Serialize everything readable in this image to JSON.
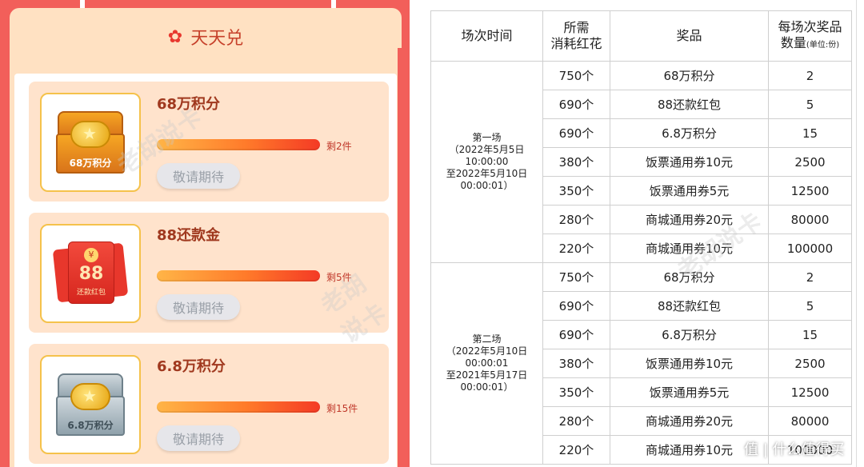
{
  "left": {
    "header_title": "天天兑",
    "items": [
      {
        "name": "68万积分",
        "thumb_label": "68万积分",
        "remain": "剩2件",
        "button": "敬请期待",
        "thumb_icon": "gold-chest-icon",
        "stock_level": 0.98
      },
      {
        "name": "88还款金",
        "thumb_num": "88",
        "thumb_sub": "还款红包",
        "remain": "剩5件",
        "button": "敬请期待",
        "thumb_icon": "red-envelope-icon",
        "stock_level": 0.98
      },
      {
        "name": "6.8万积分",
        "thumb_label": "6.8万积分",
        "remain": "剩15件",
        "button": "敬请期待",
        "thumb_icon": "silver-chest-icon",
        "stock_level": 0.98
      }
    ],
    "watermark": "老胡说卡"
  },
  "table": {
    "headers": [
      "场次时间",
      "所需\n消耗红花",
      "奖品",
      "每场次奖品\n数量"
    ],
    "header_unit": "(单位:份)",
    "sessions": [
      {
        "label_lines": [
          "第一场",
          "（2022年5月5日",
          "10:00:00",
          "至2022年5月10日",
          "00:00:01）"
        ],
        "rows": [
          [
            "750个",
            "68万积分",
            "2"
          ],
          [
            "690个",
            "88还款红包",
            "5"
          ],
          [
            "690个",
            "6.8万积分",
            "15"
          ],
          [
            "380个",
            "饭票通用券10元",
            "2500"
          ],
          [
            "350个",
            "饭票通用券5元",
            "12500"
          ],
          [
            "280个",
            "商城通用券20元",
            "80000"
          ],
          [
            "220个",
            "商城通用券10元",
            "100000"
          ]
        ]
      },
      {
        "label_lines": [
          "第二场",
          "（2022年5月10日",
          "00:00:01",
          "至2021年5月17日",
          "00:00:01）"
        ],
        "rows": [
          [
            "750个",
            "68万积分",
            "2"
          ],
          [
            "690个",
            "88还款红包",
            "5"
          ],
          [
            "690个",
            "6.8万积分",
            "15"
          ],
          [
            "380个",
            "饭票通用券10元",
            "2500"
          ],
          [
            "350个",
            "饭票通用券5元",
            "12500"
          ],
          [
            "280个",
            "商城通用券20元",
            "80000"
          ],
          [
            "220个",
            "商城通用券10元",
            "100000"
          ]
        ]
      }
    ],
    "watermark": "老胡说卡"
  },
  "brand": "值 | 什么值得买",
  "colors": {
    "red_bg": "#f25f5a",
    "card_bg": "#ffe1c2",
    "accent_text": "#a0391f"
  }
}
